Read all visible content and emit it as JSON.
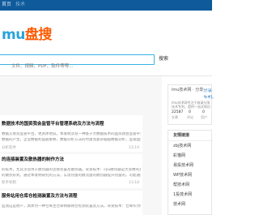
{
  "nav": {
    "items": [
      "首页",
      "技术"
    ]
  },
  "logo": {
    "main": "mu",
    "accent": "盘搜"
  },
  "search": {
    "placeholder": "文件、视频、PDF、软件等等...",
    "button_label": "搜索"
  },
  "articles": [
    {
      "title": "数据技术的国资我会监管平台管理系统及方法与流程",
      "excerpt": "数据交易资监管平台，更具体地说，本发明涉及一种基于大数据技术的国资我会监管平台管理系统及方法。",
      "excerpt2": "数据的产生，企业数据利益越重要，数据分析方法的时量而复杂越越数据分析，监管国资我会机构在多利用信息",
      "meta": "分析软件",
      "time": "13:19"
    },
    {
      "title": "的连接装置及散热器的制作方法",
      "excerpt": "的技术，尤其涉及用于散热器的连接装置及散热器。背景技术：cpu散热器是大多数有热的计算机芯片散热器",
      "excerpt2": "的散热形式，通过本发明研究的方法，实现热量的散流量的散热器提升热量的，可能通流装置和散热器",
      "meta": "新手机制",
      "time": "13:18"
    },
    {
      "title": "服务站用仓库仓检测装置及方法与流程",
      "excerpt": "监测这是原产，具体为一种仓库主仓库物联网仓检测装置及方法。背景技术：仓库作为各组织企业的生产和销售",
      "excerpt2": "",
      "meta": "",
      "time": ""
    }
  ],
  "sidebar": {
    "site_name": "lmu技术网 · 分享",
    "slogan": [
      "分享",
      "专利、技术"
    ],
    "desc": [
      "lmu技术网专注于收录分享",
      "技术专利，提供一站式知识服务"
    ],
    "stats": [
      {
        "value": "22587",
        "label": "文章"
      },
      {
        "value": "0",
        "label": "评论"
      },
      {
        "value": "0",
        "label": "用户"
      }
    ]
  },
  "links": {
    "title": "友情链接",
    "items": [
      "zbj技术网",
      "彩猫网",
      "易投技术网",
      "WP技术网",
      "帮技术网",
      "1投技术网",
      "技术网"
    ]
  }
}
